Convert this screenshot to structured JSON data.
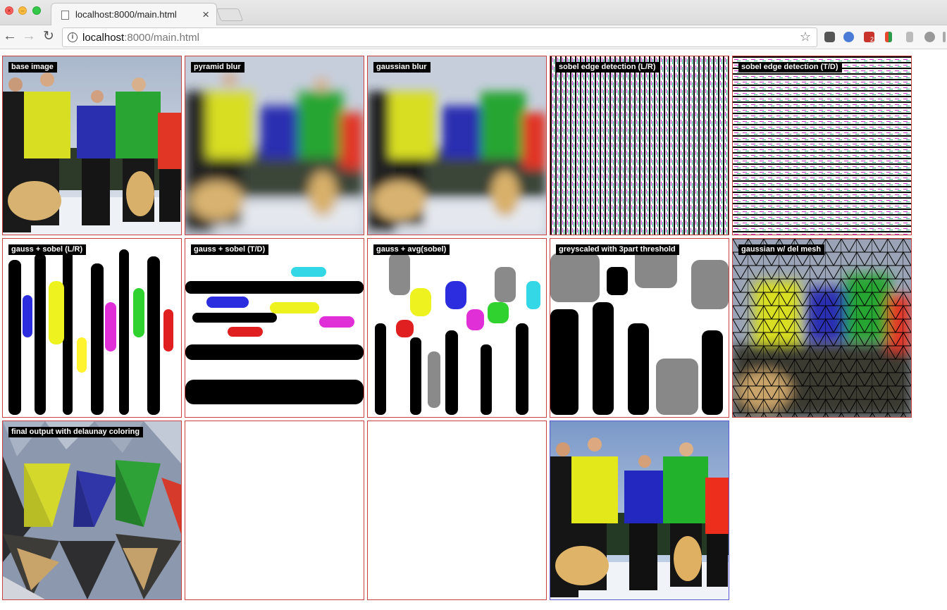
{
  "browser": {
    "tab_title": "localhost:8000/main.html",
    "url_host": "localhost",
    "url_path": ":8000/main.html",
    "ext_badge": "2"
  },
  "panels": [
    {
      "label": "base image",
      "kind": "photo"
    },
    {
      "label": "pyramid blur",
      "kind": "blur"
    },
    {
      "label": "gaussian blur",
      "kind": "blur"
    },
    {
      "label": "sobel edge detection (L/R)",
      "kind": "edges"
    },
    {
      "label": "sobel edge detection (T/D)",
      "kind": "edges"
    },
    {
      "label": "gauss + sobel (L/R)",
      "kind": "blobs"
    },
    {
      "label": "gauss + sobel (T/D)",
      "kind": "blobs"
    },
    {
      "label": "gauss + avg(sobel)",
      "kind": "blobs"
    },
    {
      "label": "greyscaled with 3part threshold",
      "kind": "threshold"
    },
    {
      "label": "gaussian w/ del mesh",
      "kind": "mesh"
    },
    {
      "label": "final output with delaunay coloring",
      "kind": "lowpoly"
    },
    {
      "label": "",
      "kind": "empty"
    },
    {
      "label": "",
      "kind": "empty"
    },
    {
      "label": "",
      "kind": "photo-result"
    }
  ],
  "colors": {
    "panel_border": "#c94040",
    "result_border": "#5a5ad0",
    "label_bg": "#000000",
    "label_fg": "#ffffff"
  }
}
